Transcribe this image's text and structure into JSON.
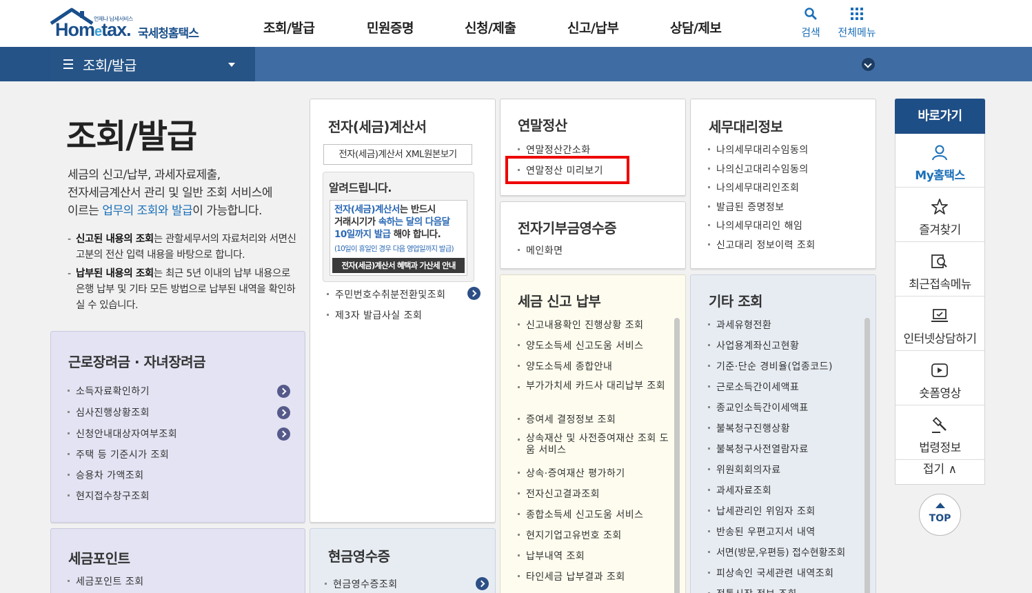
{
  "header": {
    "logo_small": "언제나 납세서비스",
    "logo_word_a": "Hom",
    "logo_word_e": "e",
    "logo_word_b": "tax.",
    "logo_kor": "국세청홈택스",
    "nav": [
      "조회/발급",
      "민원증명",
      "신청/제출",
      "신고/납부",
      "상담/제보"
    ],
    "search_label": "검색",
    "allmenu_label": "전체메뉴"
  },
  "breadcrumb": {
    "label": "조회/발급"
  },
  "intro": {
    "title": "조회/발급",
    "line1": "세금의 신고/납부, 과세자료제출,",
    "line2": "전자세금계산서 관리 및 일반 조회 서비스에",
    "line3_pre": "이르는 ",
    "line3_hl": "업무의 조회와 발급",
    "line3_post": "이 가능합니다.",
    "note1_bold": "신고된 내용의 조회",
    "note1_rest": "는 관할세무서의 자료처리와 서면신고분의 전산 입력 내용을 바탕으로 합니다.",
    "note2_bold": "납부된 내용의 조회",
    "note2_rest": "는 최근 5년 이내의 납부 내용으로 은행 납부 및 기타 모든 방법으로 납부된 내역을 확인하실 수 있습니다."
  },
  "eitc": {
    "title": "근로장려금 · 자녀장려금",
    "items": [
      "소득자료확인하기",
      "심사진행상황조회",
      "신청안내대상자여부조회",
      "주택 등 기준시가 조회",
      "승용차 가액조회",
      "현지접수창구조회"
    ]
  },
  "taxpoint": {
    "title": "세금포인트",
    "items": [
      "세금포인트 조회"
    ]
  },
  "einvoice": {
    "title": "전자(세금)계산서",
    "xml_button": "전자(세금)계산서 XML원본보기",
    "notice_title": "알려드립니다.",
    "banner_b1": "전자(세금)계산서",
    "banner_t1": "는 반드시",
    "banner_t2": "거래시기가 ",
    "banner_b2": "속하는 달의 다음달",
    "banner_b3": "10일까지 발급",
    "banner_t3": " 해야 합니다.",
    "banner_sub": "(10일이 휴일인 경우 다음 영업일까지 발급)",
    "banner_bar": "전자(세금)계산서 혜택과 가산세 안내",
    "items": [
      "주민번호수취분전환및조회",
      "제3자 발급사실 조회"
    ]
  },
  "cashreceipt": {
    "title": "현금영수증",
    "items": [
      "현금영수증조회"
    ]
  },
  "yearend": {
    "title": "연말정산",
    "items": [
      "연말정산간소화",
      "연말정산 미리보기"
    ]
  },
  "donation": {
    "title": "전자기부금영수증",
    "items": [
      "메인화면"
    ]
  },
  "taxreturn": {
    "title": "세금 신고 납부",
    "items": [
      "신고내용확인 진행상황 조회",
      "양도소득세 신고도움 서비스",
      "양도소득세 종합안내",
      "부가가치세 카드사 대리납부 조회",
      "증여세 결정정보 조회",
      "상속재산 및 사전증여재산 조회 도움 서비스",
      "상속·증여재산 평가하기",
      "전자신고결과조회",
      "종합소득세 신고도움 서비스",
      "현지기업고유번호 조회",
      "납부내역 조회",
      "타인세금 납부결과 조회"
    ]
  },
  "agent": {
    "title": "세무대리정보",
    "items": [
      "나의세무대리수임동의",
      "나의신고대리수임동의",
      "나의세무대리인조회",
      "발급된 증명정보",
      "나의세무대리인 해임",
      "신고대리 정보이력 조회"
    ]
  },
  "other": {
    "title": "기타 조회",
    "items": [
      "과세유형전환",
      "사업용계좌신고현황",
      "기준·단순 경비율(업종코드)",
      "근로소득간이세액표",
      "종교인소득간이세액표",
      "불복청구진행상황",
      "불복청구사전열람자료",
      "위원회회의자료",
      "과세자료조회",
      "납세관리인 위임자 조회",
      "반송된 우편고지서 내역",
      "서면(방문,우편등) 접수현황조회",
      "피상속인 국세관련 내역조회",
      "전통시장 정보 조회"
    ]
  },
  "quick": {
    "title": "바로가기",
    "items": [
      "My홈택스",
      "즐겨찾기",
      "최근접속메뉴",
      "인터넷상담하기",
      "숏폼영상",
      "법령정보"
    ],
    "fold": "접기",
    "top": "TOP"
  },
  "colors": {
    "brand": "#1a4f8b",
    "bar": "#3f6da3",
    "highlight": "#ee0000"
  }
}
